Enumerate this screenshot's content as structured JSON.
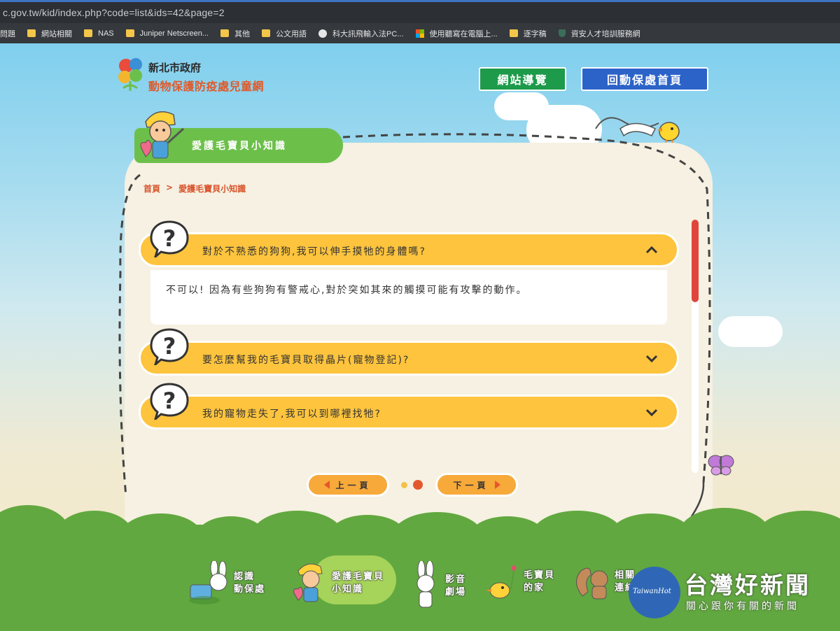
{
  "browser": {
    "url": "c.gov.tw/kid/index.php?code=list&ids=42&page=2",
    "bookmarks": [
      {
        "label": "問題",
        "icon": "none"
      },
      {
        "label": "網站相關",
        "icon": "folder-icon"
      },
      {
        "label": "NAS",
        "icon": "folder-icon"
      },
      {
        "label": "Juniper Netscreen...",
        "icon": "folder-icon"
      },
      {
        "label": "其他",
        "icon": "folder-icon"
      },
      {
        "label": "公文用語",
        "icon": "folder-icon"
      },
      {
        "label": "科大訊飛輸入法PC...",
        "icon": "globe-icon"
      },
      {
        "label": "使用聽寫在電腦上...",
        "icon": "windows-icon"
      },
      {
        "label": "逐字稿",
        "icon": "folder-icon"
      },
      {
        "label": "資安人才培訓服務網",
        "icon": "shield-icon"
      }
    ]
  },
  "site": {
    "logo_line1": "新北市政府",
    "logo_line2": "動物保護防疫處兒童網",
    "nav_guide": "網站導覽",
    "nav_home": "回動保處首頁"
  },
  "section": {
    "title": "愛護毛寶貝小知識",
    "breadcrumb_home": "首頁",
    "breadcrumb_sep": ">",
    "breadcrumb_current": "愛護毛寶貝小知識"
  },
  "faq": [
    {
      "question": "對於不熟悉的狗狗,我可以伸手摸牠的身體嗎?",
      "answer": "不可以! 因為有些狗狗有警戒心,對於突如其來的觸摸可能有攻擊的動作。",
      "expanded": true
    },
    {
      "question": "要怎麼幫我的毛寶貝取得晶片(寵物登記)?",
      "expanded": false
    },
    {
      "question": "我的寵物走失了,我可以到哪裡找牠?",
      "expanded": false
    }
  ],
  "pagination": {
    "prev": "上一頁",
    "next": "下一頁",
    "current_page": 2,
    "total_pages": 2
  },
  "footer_nav": [
    {
      "line1": "認識",
      "line2": "動保處"
    },
    {
      "line1": "愛護毛寶貝",
      "line2": "小知識"
    },
    {
      "line1": "影音",
      "line2": "劇場"
    },
    {
      "line1": "毛寶貝",
      "line2": "的家"
    },
    {
      "line1": "相關",
      "line2": "連結"
    }
  ],
  "watermark": {
    "logo_text": "TaiwanHot",
    "title": "台灣好新聞",
    "subtitle": "關心跟你有關的新聞"
  },
  "colors": {
    "qa_bar": "#fec43d",
    "scroll_thumb": "#e0453b",
    "nav_green": "#1d9a4a",
    "nav_blue": "#2c63c8",
    "ground": "#62a840"
  }
}
